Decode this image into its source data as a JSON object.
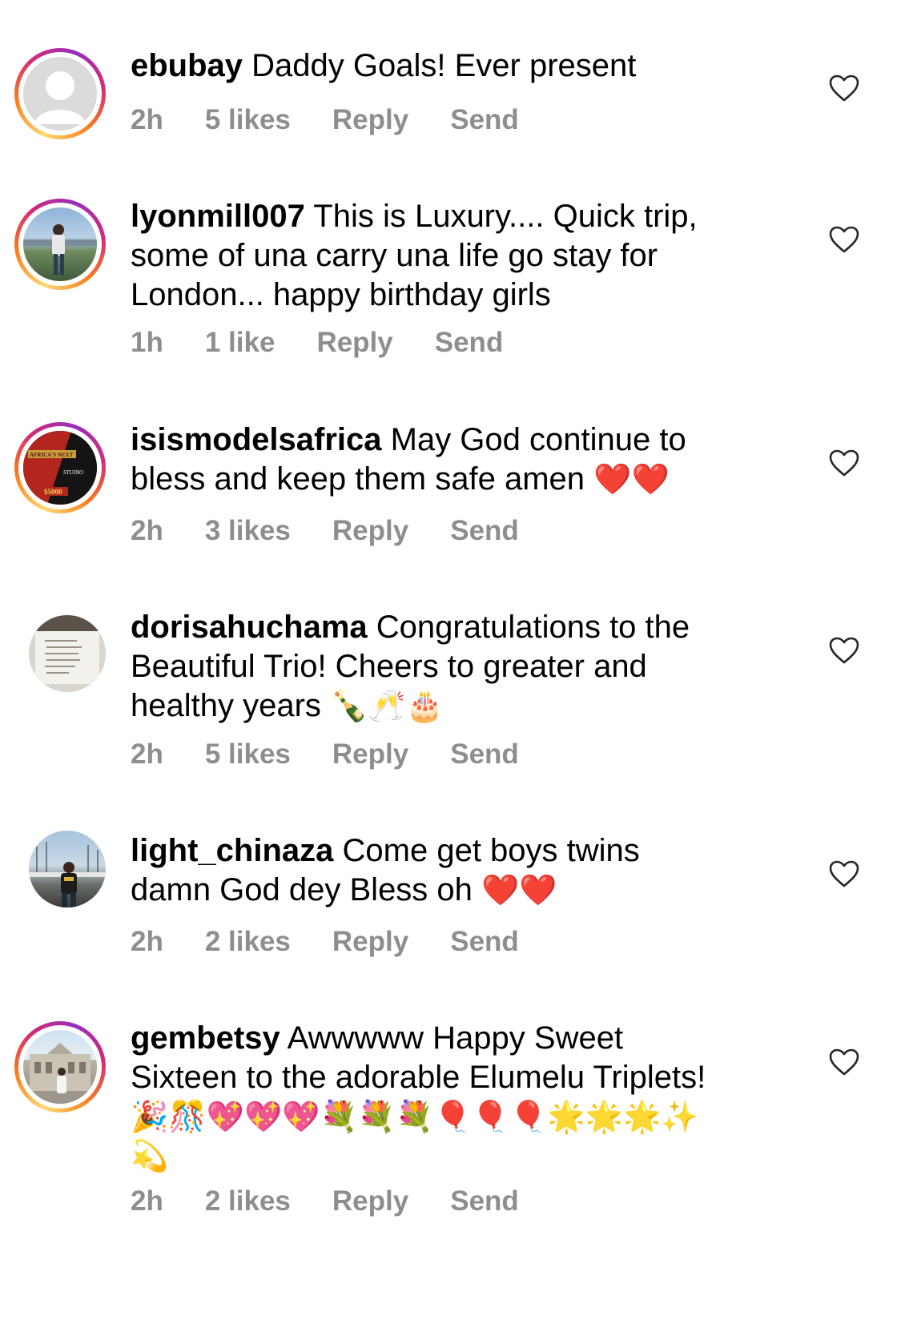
{
  "colors": {
    "meta_text": "#8e8e8e",
    "heart_emoji": "#e0201f",
    "story_ring": [
      "#feda75",
      "#fa7e1e",
      "#d62976",
      "#962fbf"
    ]
  },
  "comments": [
    {
      "username": "ebubay",
      "text": "Daddy Goals! Ever present",
      "emojis": "",
      "time": "2h",
      "likes": "5 likes",
      "reply": "Reply",
      "send": "Send",
      "avatar": "default-avatar-icon"
    },
    {
      "username": "lyonmill007",
      "text": "This is Luxury.... Quick trip, some of una carry una life go stay for London... happy birthday girls",
      "emojis": "",
      "time": "1h",
      "likes": "1 like",
      "reply": "Reply",
      "send": "Send",
      "avatar": "person-photo"
    },
    {
      "username": "isismodelsafrica",
      "text": "May God continue to bless and keep them safe amen",
      "emojis": "❤️❤️",
      "time": "2h",
      "likes": "3 likes",
      "reply": "Reply",
      "send": "Send",
      "avatar": "poster-photo",
      "avatar_texts": [
        "AFRICA'S NEXT",
        "STUDIO",
        "$5000"
      ]
    },
    {
      "username": "dorisahuchama",
      "text": "Congratulations to the Beautiful Trio! Cheers to greater and healthy years",
      "emojis": "🍾🥂🎂",
      "time": "2h",
      "likes": "5 likes",
      "reply": "Reply",
      "send": "Send",
      "avatar": "quote-photo"
    },
    {
      "username": "light_chinaza",
      "text": "Come get boys twins damn God dey Bless oh",
      "emojis": "❤️❤️",
      "time": "2h",
      "likes": "2 likes",
      "reply": "Reply",
      "send": "Send",
      "avatar": "person-photo"
    },
    {
      "username": "gembetsy",
      "text": "Awwwww Happy Sweet Sixteen to the adorable Elumelu Triplets!",
      "emojis": "🎉🎊💖💖💖💐💐💐🎈🎈🎈🌟🌟🌟✨💫",
      "time": "2h",
      "likes": "2 likes",
      "reply": "Reply",
      "send": "Send",
      "avatar": "building-photo"
    }
  ]
}
